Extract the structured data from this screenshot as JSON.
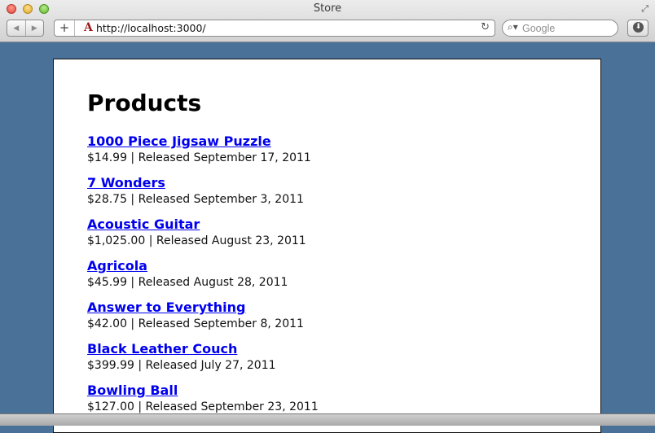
{
  "window": {
    "title": "Store",
    "buttons": {
      "close_color": "#e0443a",
      "minimize_color": "#e0a628",
      "maximize_color": "#62b832"
    }
  },
  "toolbar": {
    "back_icon": "◀",
    "forward_icon": "▶",
    "add_icon": "+",
    "url": "http://localhost:3000/",
    "reload_icon": "↻",
    "search_placeholder": "Google",
    "search_icon": "🔍",
    "download_icon": "⬇"
  },
  "page": {
    "title": "Products",
    "background_color": "#4a7299",
    "link_color": "#0000ee",
    "products": [
      {
        "name": "1000 Piece Jigsaw Puzzle",
        "details": "$14.99 | Released September 17, 2011"
      },
      {
        "name": "7 Wonders",
        "details": "$28.75 | Released September 3, 2011"
      },
      {
        "name": "Acoustic Guitar",
        "details": "$1,025.00 | Released August 23, 2011"
      },
      {
        "name": "Agricola",
        "details": "$45.99 | Released August 28, 2011"
      },
      {
        "name": "Answer to Everything",
        "details": "$42.00 | Released September 8, 2011"
      },
      {
        "name": "Black Leather Couch",
        "details": "$399.99 | Released July 27, 2011"
      },
      {
        "name": "Bowling Ball",
        "details": "$127.00 | Released September 23, 2011"
      }
    ]
  }
}
